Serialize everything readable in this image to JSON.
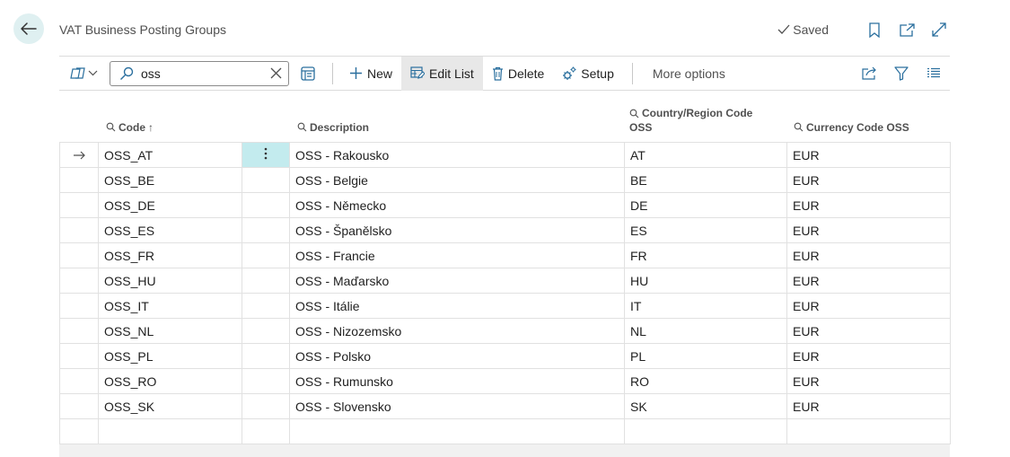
{
  "page": {
    "title": "VAT Business Posting Groups",
    "saved_label": "Saved"
  },
  "toolbar": {
    "search_value": "oss",
    "new_label": "New",
    "edit_list_label": "Edit List",
    "delete_label": "Delete",
    "setup_label": "Setup",
    "more_options_label": "More options"
  },
  "columns": {
    "code": "Code",
    "code_sort": "↑",
    "description": "Description",
    "country_line1": "Country/Region Code",
    "country_line2": "OSS",
    "currency": "Currency Code OSS"
  },
  "rows": [
    {
      "code": "OSS_AT",
      "description": "OSS - Rakousko",
      "country": "AT",
      "currency": "EUR",
      "selected": true
    },
    {
      "code": "OSS_BE",
      "description": "OSS - Belgie",
      "country": "BE",
      "currency": "EUR"
    },
    {
      "code": "OSS_DE",
      "description": "OSS - Německo",
      "country": "DE",
      "currency": "EUR"
    },
    {
      "code": "OSS_ES",
      "description": "OSS - Španělsko",
      "country": "ES",
      "currency": "EUR"
    },
    {
      "code": "OSS_FR",
      "description": "OSS - Francie",
      "country": "FR",
      "currency": "EUR"
    },
    {
      "code": "OSS_HU",
      "description": "OSS - Maďarsko",
      "country": "HU",
      "currency": "EUR"
    },
    {
      "code": "OSS_IT",
      "description": "OSS - Itálie",
      "country": "IT",
      "currency": "EUR"
    },
    {
      "code": "OSS_NL",
      "description": "OSS - Nizozemsko",
      "country": "NL",
      "currency": "EUR"
    },
    {
      "code": "OSS_PL",
      "description": "OSS - Polsko",
      "country": "PL",
      "currency": "EUR"
    },
    {
      "code": "OSS_RO",
      "description": "OSS - Rumunsko",
      "country": "RO",
      "currency": "EUR"
    },
    {
      "code": "OSS_SK",
      "description": "OSS - Slovensko",
      "country": "SK",
      "currency": "EUR"
    }
  ],
  "icons": {
    "back": "back-arrow-icon",
    "saved": "checkmark-icon",
    "bookmark": "bookmark-icon",
    "open_new": "open-in-new-window-icon",
    "expand": "expand-icon",
    "views": "views-icon",
    "search": "search-icon",
    "clear": "close-icon",
    "list_view": "list-view-icon",
    "new": "plus-icon",
    "edit_list": "edit-list-icon",
    "delete": "trash-icon",
    "setup": "gear-icon",
    "share": "share-icon",
    "filter": "filter-icon",
    "list_layout": "list-layout-icon",
    "row_pointer": "row-arrow-icon",
    "row_menu": "more-vertical-icon"
  },
  "colors": {
    "accent": "#dff0f1",
    "selected_cell": "#c3ebee",
    "active_button": "#e8e8e8"
  }
}
